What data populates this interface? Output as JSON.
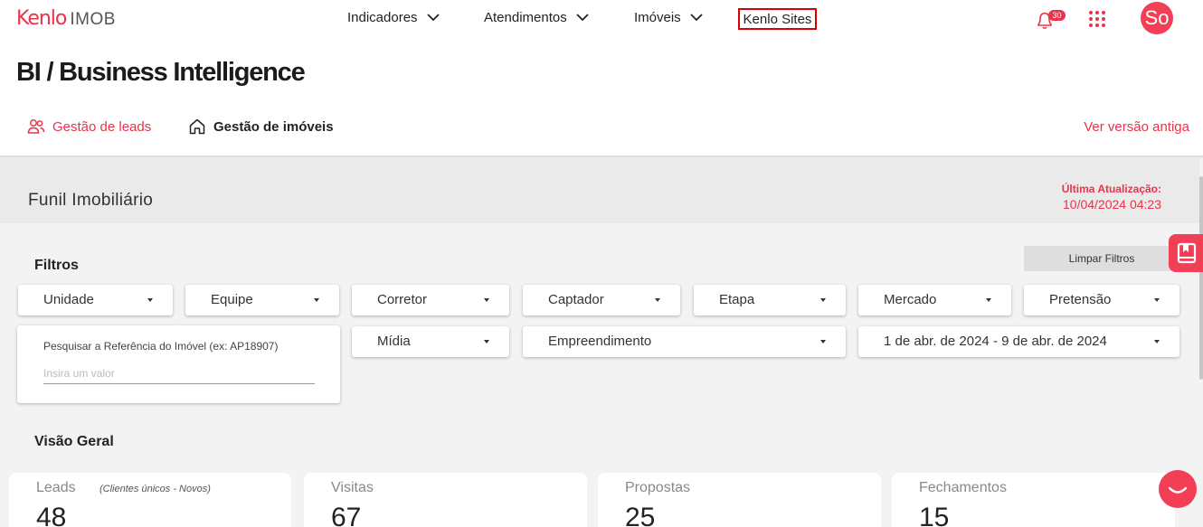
{
  "brand": {
    "logo_main": "Kenlo",
    "logo_sub": "IMOB",
    "accent": "#e8334a"
  },
  "nav": {
    "items": [
      {
        "label": "Indicadores"
      },
      {
        "label": "Atendimentos"
      },
      {
        "label": "Imóveis"
      }
    ],
    "kenlo_sites": "Kenlo Sites",
    "notifications_count": "30",
    "avatar_initials": "So"
  },
  "page": {
    "title": "BI / Business Intelligence"
  },
  "tabs": {
    "leads": "Gestão de leads",
    "imoveis": "Gestão de imóveis",
    "active": "leads",
    "old_version": "Ver versão antiga"
  },
  "funnel": {
    "title": "Funil Imobiliário",
    "last_update_label": "Última Atualização:",
    "last_update_value": "10/04/2024 04:23"
  },
  "filters": {
    "label": "Filtros",
    "clear": "Limpar Filtros",
    "row1": [
      "Unidade",
      "Equipe",
      "Corretor",
      "Captador",
      "Etapa",
      "Mercado",
      "Pretensão"
    ],
    "midia": "Mídia",
    "empreendimento": "Empreendimento",
    "date_range": "1 de abr. de 2024 - 9 de abr. de 2024",
    "reference_label": "Pesquisar a Referência do Imóvel (ex: AP18907)",
    "reference_placeholder": "Insira um valor"
  },
  "overview": {
    "label": "Visão Geral",
    "cards": [
      {
        "title": "Leads",
        "note": "(Clientes únicos - Novos)",
        "value": "48"
      },
      {
        "title": "Visitas",
        "value": "67"
      },
      {
        "title": "Propostas",
        "value": "25"
      },
      {
        "title": "Fechamentos",
        "value": "15"
      }
    ]
  },
  "icons": [
    "chevron-down-icon",
    "bell-icon",
    "apps-grid-icon",
    "users-icon",
    "home-icon",
    "bookmark-icon",
    "chat-icon"
  ]
}
